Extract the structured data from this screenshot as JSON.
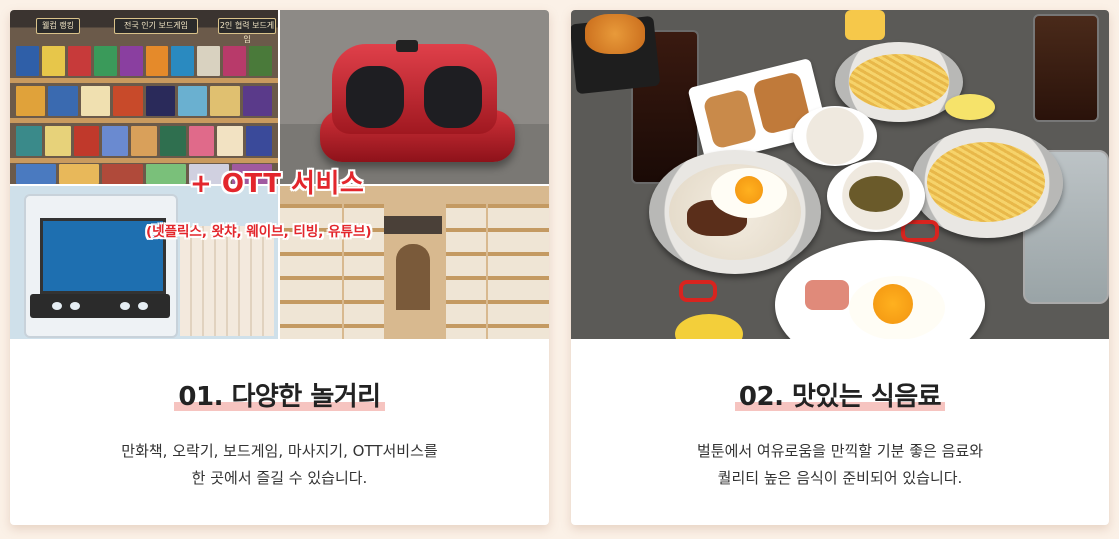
{
  "cards": [
    {
      "id": "play",
      "photo_signs": [
        "웰컴 랭킹",
        "전국 인기 보드게임",
        "2인 협력 보드게임"
      ],
      "overlay_title": "+ OTT 서비스",
      "overlay_subtitle": "(넷플릭스, 왓챠, 웨이브, 티빙, 유튜브)",
      "heading": "01. 다양한 놀거리",
      "desc_line1": "만화책, 오락기, 보드게임, 마사지기, OTT서비스를",
      "desc_line2": "한 곳에서 즐길 수 있습니다."
    },
    {
      "id": "food",
      "heading": "02. 맛있는 식음료",
      "desc_line1": "벌툰에서 여유로움을 만끽할 기분 좋은 음료와",
      "desc_line2": "퀄리티 높은 음식이 준비되어 있습니다."
    }
  ],
  "colors": {
    "background": "#fbf1e7",
    "accent_red": "#e3262c",
    "highlight_pink": "#f6c4c0",
    "heading_text": "#222222"
  }
}
